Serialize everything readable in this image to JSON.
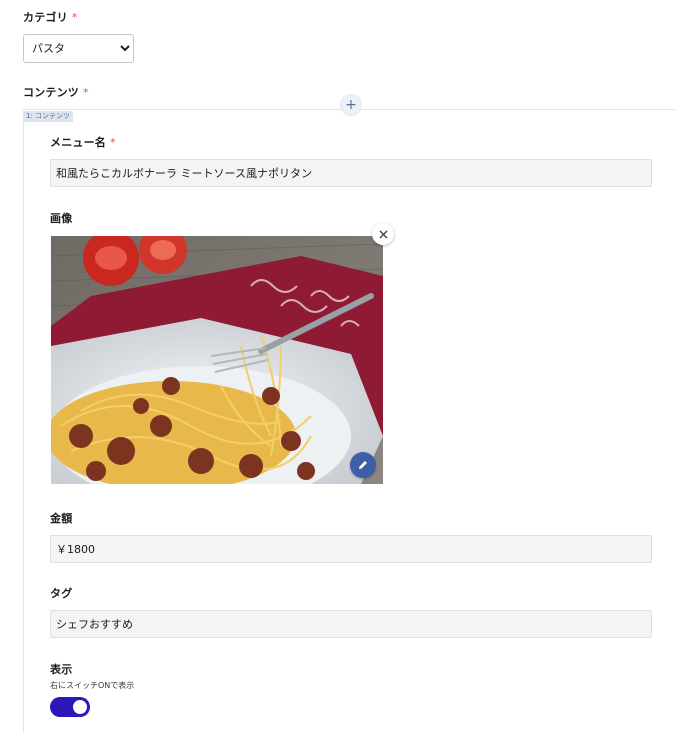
{
  "category": {
    "label": "カテゴリ",
    "required_mark": "*",
    "selected": "パスタ"
  },
  "contents": {
    "label": "コンテンツ",
    "required_mark": "*",
    "block_tag": "1: コンテンツ",
    "add_icon": "plus-icon"
  },
  "menu_name": {
    "label": "メニュー名",
    "required_mark": "*",
    "value": "和風たらこカルボナーラ ミートソース風ナポリタン"
  },
  "image": {
    "label": "画像",
    "remove_icon": "close-icon",
    "edit_icon": "pencil-icon"
  },
  "price": {
    "label": "金額",
    "value": "￥1800"
  },
  "tag": {
    "label": "タグ",
    "value": "シェフおすすめ"
  },
  "display": {
    "label": "表示",
    "help": "右にスイッチONで表示",
    "toggle_on": true
  },
  "colors": {
    "required": "#e0533f",
    "toggle_on": "#2a19b8",
    "edit_button": "#3d5fa8"
  }
}
